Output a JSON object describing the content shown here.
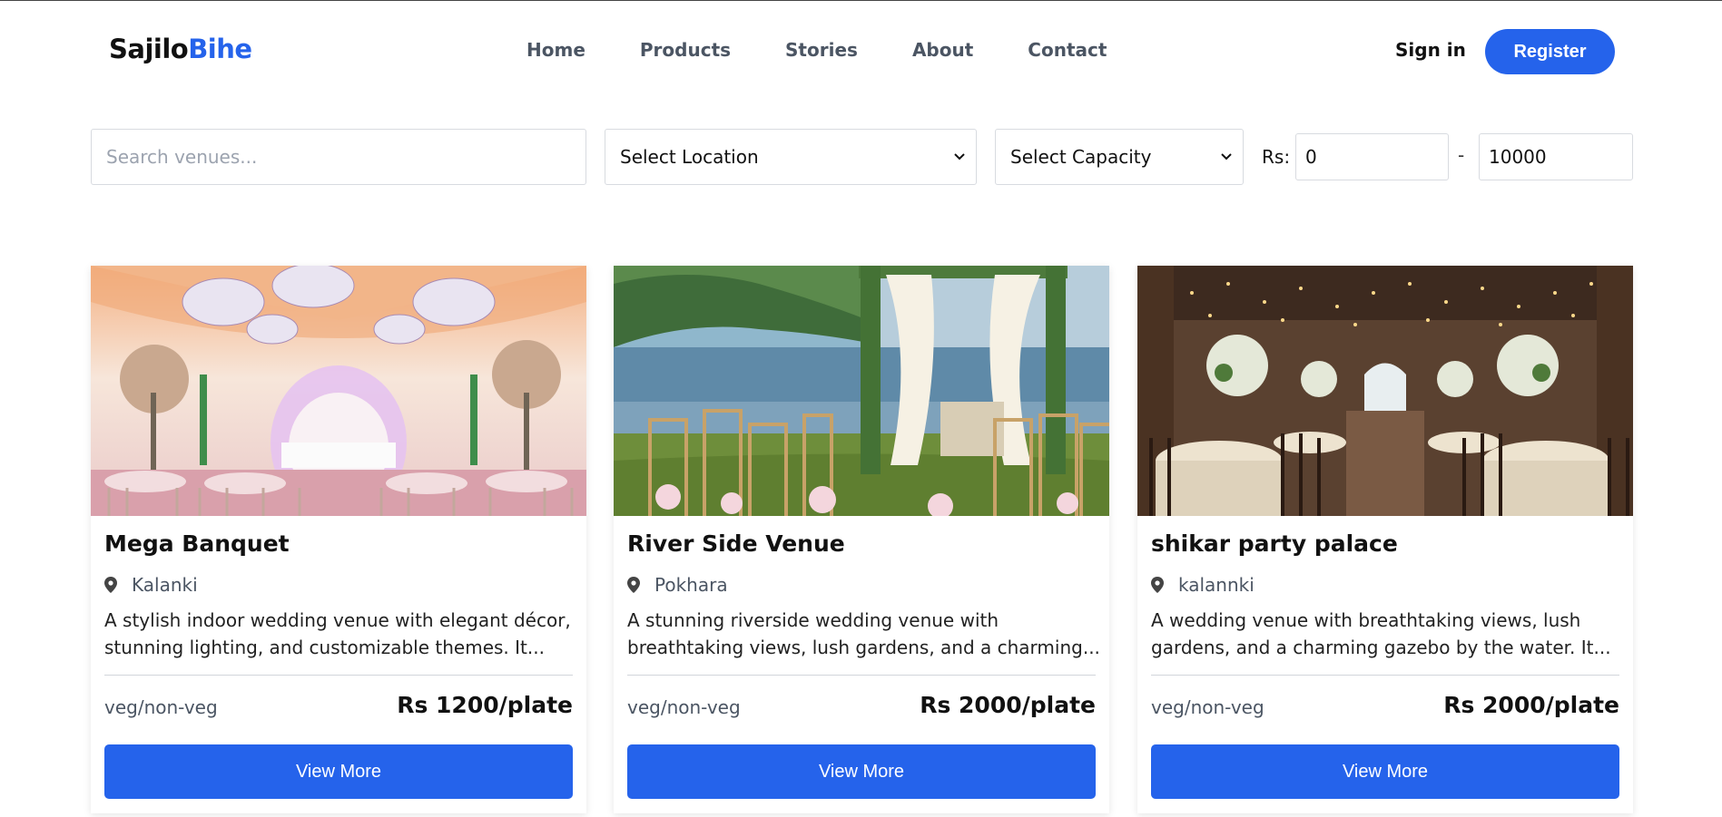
{
  "header": {
    "logo_part1": "Sajilo",
    "logo_part2": "Bihe",
    "nav": [
      "Home",
      "Products",
      "Stories",
      "About",
      "Contact"
    ],
    "signin": "Sign in",
    "register": "Register",
    "accent_color": "#2563eb"
  },
  "filters": {
    "search_placeholder": "Search venues...",
    "location": "Select Location",
    "capacity": "Select Capacity",
    "rs_label": "Rs:",
    "min_price": "0",
    "dash": "-",
    "max_price": "10000"
  },
  "cards": [
    {
      "title": "Mega Banquet",
      "location": "Kalanki",
      "desc1": "A stylish indoor wedding venue with elegant décor,",
      "desc2": "stunning lighting, and customizable themes. It...",
      "food": "veg/non-veg",
      "price": "Rs 1200/plate",
      "button": "View More"
    },
    {
      "title": "River Side Venue",
      "location": "Pokhara",
      "desc1": "A stunning riverside wedding venue with",
      "desc2": "breathtaking views, lush gardens, and a charming...",
      "food": "veg/non-veg",
      "price": "Rs 2000/plate",
      "button": "View More"
    },
    {
      "title": "shikar party palace",
      "location": "kalannki",
      "desc1": "A wedding venue with breathtaking views, lush",
      "desc2": "gardens, and a charming gazebo by the water. It...",
      "food": "veg/non-veg",
      "price": "Rs 2000/plate",
      "button": "View More"
    }
  ]
}
